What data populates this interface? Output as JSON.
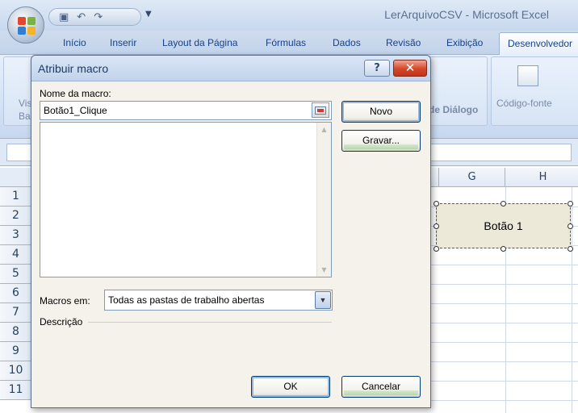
{
  "window": {
    "title": "LerArquivoCSV - Microsoft Excel"
  },
  "ribbon": {
    "tabs": [
      "Início",
      "Inserir",
      "Layout da Página",
      "Fórmulas",
      "Dados",
      "Revisão",
      "Exibição",
      "Desenvolvedor"
    ],
    "partial_labels": {
      "left_top": "Vis",
      "left_bottom": "Ba",
      "dialog_group": "de Diálogo",
      "code_source": "Código-fonte"
    }
  },
  "sheet": {
    "columns": [
      "G",
      "H"
    ],
    "rows": [
      "1",
      "2",
      "3",
      "4",
      "5",
      "6",
      "7",
      "8",
      "9",
      "10",
      "11"
    ],
    "form_button_label": "Botão 1"
  },
  "dialog": {
    "title": "Atribuir macro",
    "help_label": "?",
    "close_label": "✕",
    "macro_name_label": "Nome da macro:",
    "macro_name_value": "Botão1_Clique",
    "new_button": "Novo",
    "record_button": "Gravar...",
    "macros_in_label": "Macros em:",
    "macros_in_value": "Todas as pastas de trabalho abertas",
    "description_label": "Descrição",
    "ok_button": "OK",
    "cancel_button": "Cancelar"
  },
  "colors": {
    "accent": "#15428b",
    "close": "#c0361b",
    "dialog_bg": "#f4f2ea"
  }
}
